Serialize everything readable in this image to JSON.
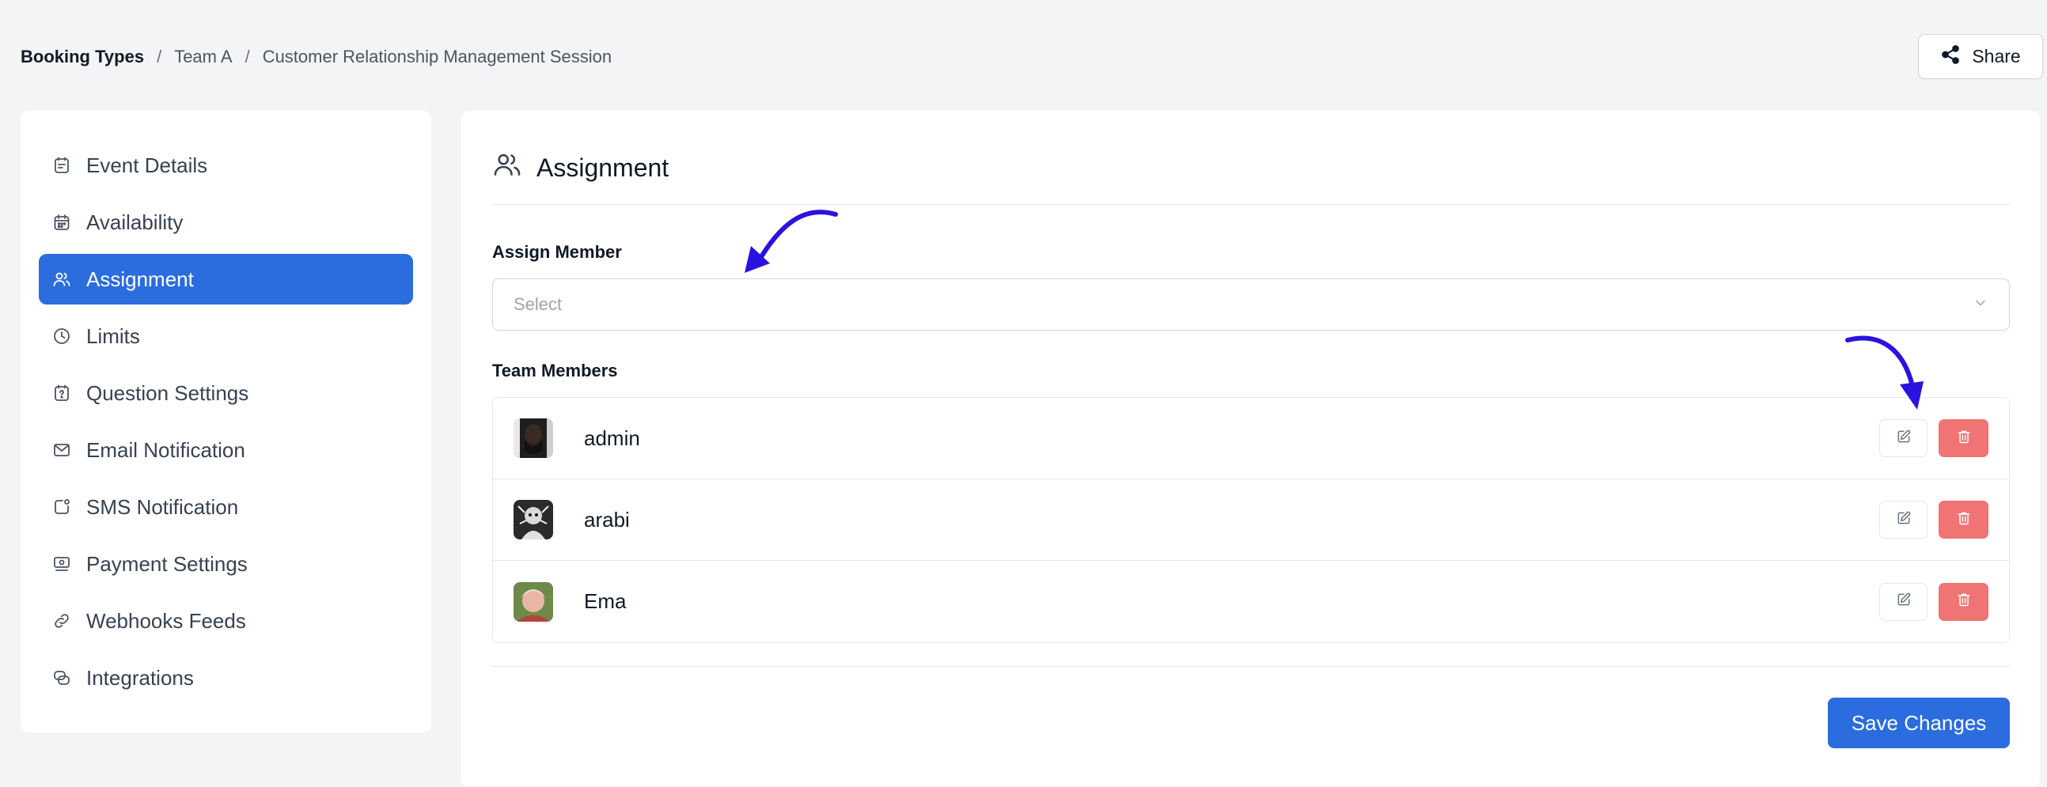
{
  "breadcrumb": {
    "root": "Booking Types",
    "team": "Team A",
    "current": "Customer Relationship Management Session",
    "separator": "/"
  },
  "header": {
    "share_label": "Share"
  },
  "sidebar": {
    "items": [
      {
        "label": "Event Details",
        "icon": "event-details-icon"
      },
      {
        "label": "Availability",
        "icon": "calendar-icon"
      },
      {
        "label": "Assignment",
        "icon": "users-icon",
        "active": true
      },
      {
        "label": "Limits",
        "icon": "clock-icon"
      },
      {
        "label": "Question Settings",
        "icon": "question-icon"
      },
      {
        "label": "Email Notification",
        "icon": "mail-icon"
      },
      {
        "label": "SMS Notification",
        "icon": "sms-icon"
      },
      {
        "label": "Payment Settings",
        "icon": "payment-icon"
      },
      {
        "label": "Webhooks Feeds",
        "icon": "link-icon"
      },
      {
        "label": "Integrations",
        "icon": "integrations-icon"
      }
    ]
  },
  "main": {
    "title": "Assignment",
    "assign_member": {
      "label": "Assign Member",
      "placeholder": "Select"
    },
    "team_members": {
      "label": "Team Members",
      "members": [
        {
          "name": "admin"
        },
        {
          "name": "arabi"
        },
        {
          "name": "Ema"
        }
      ]
    },
    "save_label": "Save Changes"
  },
  "colors": {
    "primary": "#2b6cde",
    "danger": "#f07474",
    "annotation": "#2a12e0",
    "background": "#f3f4f6"
  }
}
